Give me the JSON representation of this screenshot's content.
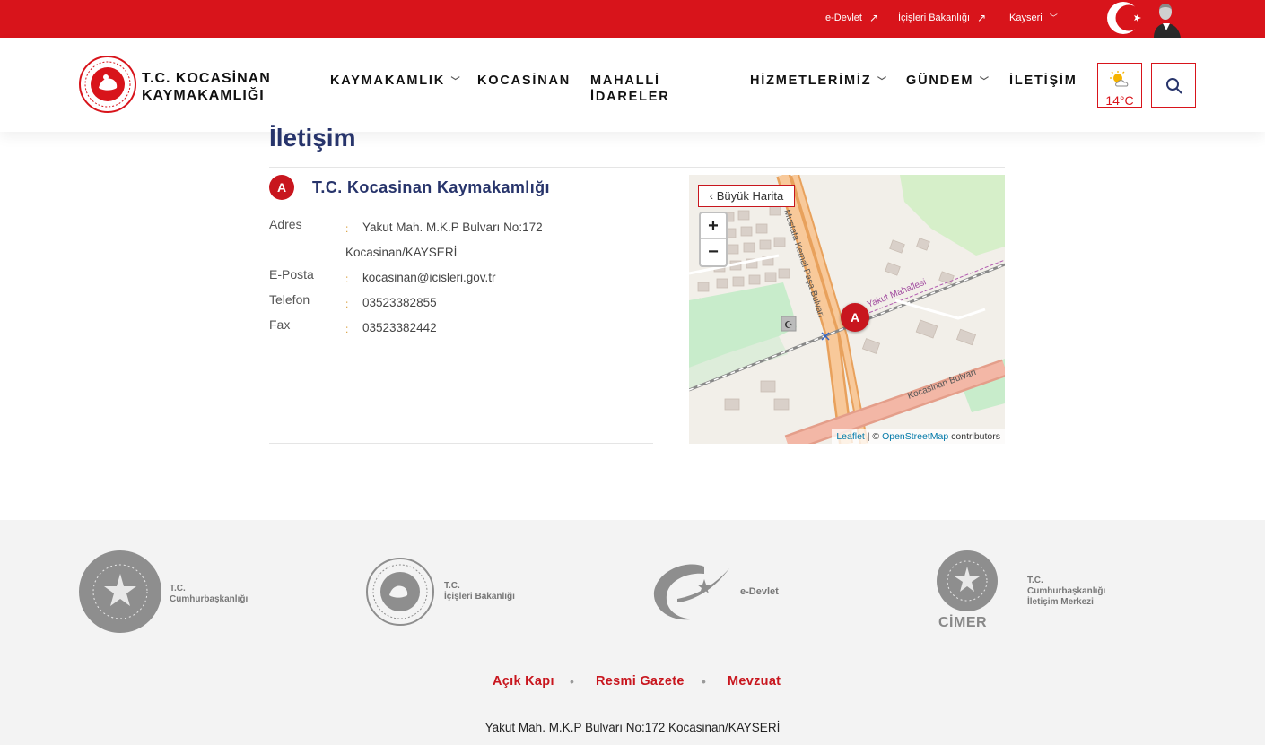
{
  "topbar": {
    "links": [
      "e-Devlet",
      "İçişleri Bakanlığı",
      "Kayseri"
    ],
    "bg_color": "#d8141b"
  },
  "header": {
    "brand_line1": "T.C. KOCASİNAN",
    "brand_line2": "KAYMAKAMLIĞI",
    "nav": {
      "kaymakamlik": "KAYMAKAMLIK",
      "kocasinan": "KOCASİNAN",
      "mahalli_1": "MAHALLİ",
      "mahalli_2": "İDARELER",
      "hizmetlerimiz": "HİZMETLERİMİZ",
      "gundem": "GÜNDEM",
      "iletisim": "İLETİŞİM"
    },
    "weather": {
      "temp": "14°C",
      "icon": "partly-cloudy-icon"
    },
    "search_icon": "search-icon"
  },
  "main": {
    "title": "İletişim",
    "marker": "A",
    "institution": "T.C. Kocasinan Kaymakamlığı",
    "fields": {
      "adres_label": "Adres",
      "adres_line1": "Yakut Mah. M.K.P Bulvarı No:172",
      "adres_line2": "Kocasinan/KAYSERİ",
      "eposta_label": "E-Posta",
      "eposta_value": "kocasinan@icisleri.gov.tr",
      "telefon_label": "Telefon",
      "telefon_value": "03523382855",
      "fax_label": "Fax",
      "fax_value": "03523382442"
    },
    "colon": ":"
  },
  "map": {
    "big_map_label": "Büyük Harita",
    "zoom_in": "+",
    "zoom_out": "−",
    "pin": "A",
    "street_1": "Mustafa Kemal Paşa Bulvarı",
    "street_2": "Yakut Mahallesi",
    "street_3": "Kocasinan Bulvarı",
    "attribution_leaflet": "Leaflet",
    "attribution_sep": "| ©",
    "attribution_osm": "OpenStreetMap",
    "attribution_tail": "contributors"
  },
  "footer": {
    "logos": {
      "cumhurbaskanligi": [
        "T.C.",
        "Cumhurbaşkanlığı"
      ],
      "icisleri": [
        "T.C.",
        "İçişleri Bakanlığı"
      ],
      "edevlet": "e-Devlet",
      "cimer": [
        "T.C.",
        "Cumhurbaşkanlığı",
        "İletişim Merkezi"
      ],
      "cimer_word": "CİMER"
    },
    "links": [
      "Açık Kapı",
      "Resmi Gazete",
      "Mevzuat"
    ],
    "separator": "•",
    "address": "Yakut Mah. M.K.P Bulvarı No:172 Kocasinan/KAYSERİ"
  }
}
